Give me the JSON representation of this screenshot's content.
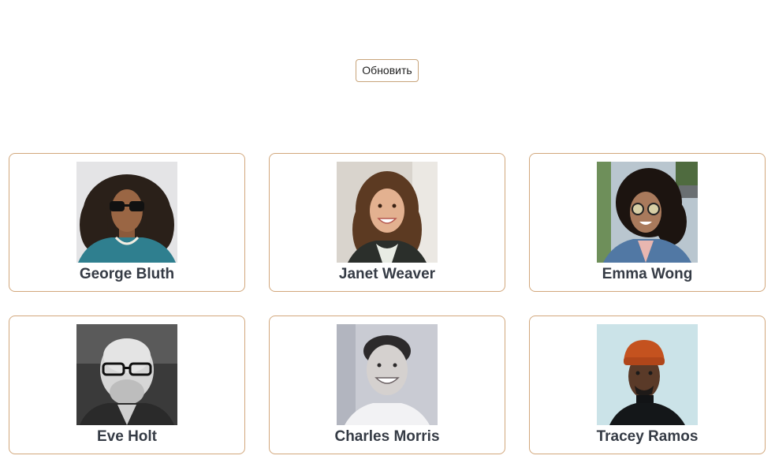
{
  "refresh_label": "Обновить",
  "users": [
    {
      "name": "George Bluth",
      "avatar": "man-curly-hair-sunglasses-photo"
    },
    {
      "name": "Janet Weaver",
      "avatar": "woman-smiling-brown-hair-photo"
    },
    {
      "name": "Emma Wong",
      "avatar": "woman-curly-hair-sunglasses-photo"
    },
    {
      "name": "Eve Holt",
      "avatar": "bald-man-glasses-beard-bw-photo"
    },
    {
      "name": "Charles Morris",
      "avatar": "man-smiling-bw-photo"
    },
    {
      "name": "Tracey Ramos",
      "avatar": "man-orange-beanie-photo"
    }
  ],
  "colors": {
    "card_border": "#d2a77c",
    "name_text": "#353b45"
  }
}
